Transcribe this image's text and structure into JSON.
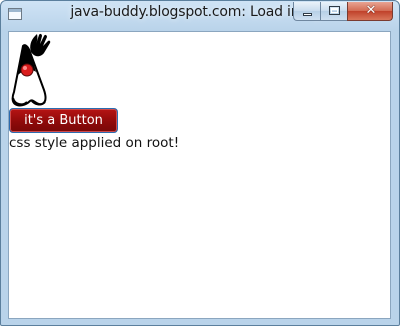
{
  "window": {
    "title": "java-buddy.blogspot.com: Load image",
    "icons": {
      "app": "window-app-icon",
      "minimize": "minimize-icon",
      "maximize": "maximize-icon",
      "close": "close-icon"
    },
    "close_glyph": "✕",
    "colors": {
      "frame": "#b9d3ea",
      "close_button": "#c0412a"
    }
  },
  "content": {
    "image": "duke-mascot",
    "button_label": "it's a Button",
    "label_text": "css style applied on root!",
    "colors": {
      "button_background": "#8f0a0a",
      "button_border": "#2c6cb0",
      "button_text": "#ffffff"
    }
  }
}
